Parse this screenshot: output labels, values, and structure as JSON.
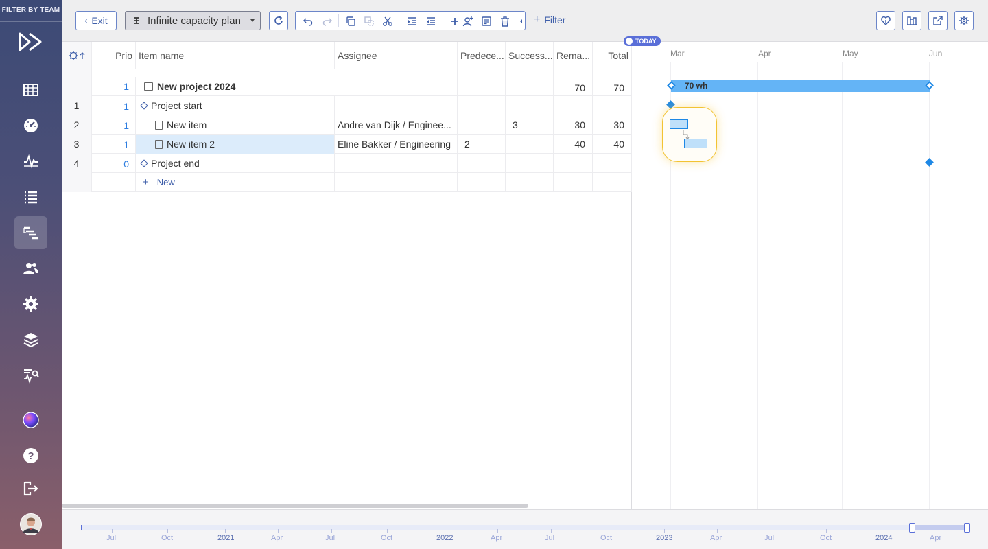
{
  "sidebar": {
    "filter_label": "FILTER BY TEAM",
    "items": [
      {
        "icon": "table-icon"
      },
      {
        "icon": "dashboard-icon"
      },
      {
        "icon": "activity-icon"
      },
      {
        "icon": "list-icon"
      },
      {
        "icon": "gantt-icon",
        "active": true
      },
      {
        "icon": "users-icon"
      },
      {
        "icon": "gear-icon"
      },
      {
        "icon": "layers-icon"
      },
      {
        "icon": "analytics-icon"
      },
      {
        "icon": "orb-icon"
      },
      {
        "icon": "help-icon"
      },
      {
        "icon": "logout-icon"
      },
      {
        "icon": "avatar"
      }
    ]
  },
  "toolbar": {
    "exit_label": "Exit",
    "plan_label": "Infinite capacity plan",
    "filter_label": "Filter"
  },
  "grid": {
    "headers": {
      "prio": "Prio",
      "item_name": "Item name",
      "assignee": "Assignee",
      "predecessors": "Predece...",
      "successors": "Success...",
      "remaining": "Rema...",
      "total": "Total"
    },
    "rows": [
      {
        "num": "",
        "prio": "1",
        "name": "New project 2024",
        "assignee": "",
        "pred": "",
        "succ": "",
        "remaining": "70",
        "total": "70"
      },
      {
        "num": "1",
        "prio": "1",
        "name": "Project start",
        "assignee": "",
        "pred": "",
        "succ": "",
        "remaining": "",
        "total": ""
      },
      {
        "num": "2",
        "prio": "1",
        "name": "New item",
        "assignee": "Andre van Dijk / Enginee...",
        "pred": "",
        "succ": "3",
        "remaining": "30",
        "total": "30"
      },
      {
        "num": "3",
        "prio": "1",
        "name": "New item 2",
        "assignee": "Eline Bakker / Engineering",
        "pred": "2",
        "succ": "",
        "remaining": "40",
        "total": "40"
      },
      {
        "num": "4",
        "prio": "0",
        "name": "Project end",
        "assignee": "",
        "pred": "",
        "succ": "",
        "remaining": "",
        "total": ""
      }
    ],
    "new_label": "New"
  },
  "gantt": {
    "today_label": "TODAY",
    "months": [
      "Mar",
      "Apr",
      "May",
      "Jun"
    ],
    "project_bar_label": "70 wh"
  },
  "timeline": {
    "labels": [
      "Jul",
      "Oct",
      "2021",
      "Apr",
      "Jul",
      "Oct",
      "2022",
      "Apr",
      "Jul",
      "Oct",
      "2023",
      "Apr",
      "Jul",
      "Oct",
      "2024",
      "Apr"
    ]
  }
}
